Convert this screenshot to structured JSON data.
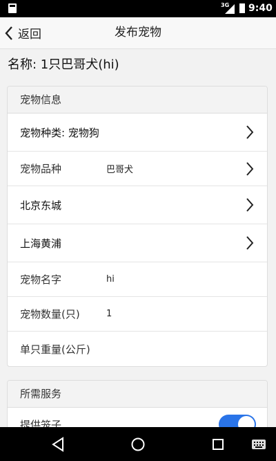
{
  "status_bar": {
    "network": "3G",
    "time": "9:40"
  },
  "app_bar": {
    "back_label": "返回",
    "title": "发布宠物"
  },
  "name_line": "名称: 1只巴哥犬(hi)",
  "pet_info": {
    "header": "宠物信息",
    "rows": [
      {
        "label": "宠物种类: 宠物狗",
        "value": ""
      },
      {
        "label": "宠物品种",
        "value": "巴哥犬"
      },
      {
        "label": "北京东城",
        "value": ""
      },
      {
        "label": "上海黄浦",
        "value": ""
      },
      {
        "label": "宠物名字",
        "value": "hi"
      },
      {
        "label": "宠物数量(只)",
        "value": "1"
      },
      {
        "label": "单只重量(公斤)",
        "value": ""
      }
    ]
  },
  "services": {
    "header": "所需服务",
    "rows": [
      {
        "label": "提供笼子",
        "switch_on": true
      }
    ]
  },
  "colors": {
    "accent": "#2a74e8"
  },
  "icons": [
    "back-arrow-icon",
    "chevron-right-icon",
    "nav-back-icon",
    "nav-home-icon",
    "nav-recents-icon",
    "keyboard-icon"
  ]
}
